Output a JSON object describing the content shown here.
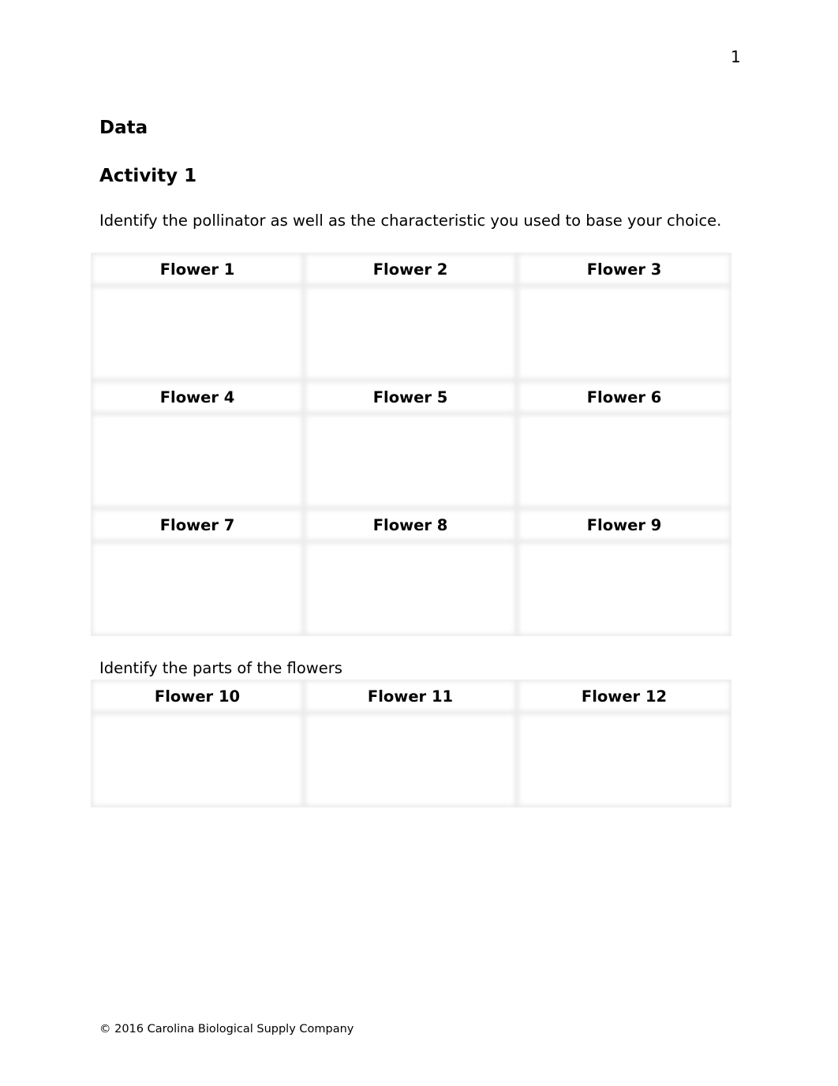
{
  "page_number": "1",
  "heading": "Data",
  "subheading": "Activity 1",
  "instructions_1": "Identify the pollinator as well as the characteristic you used to base your choice.",
  "table_1": {
    "rows": [
      [
        "Flower 1",
        "Flower 2",
        "Flower 3"
      ],
      [
        "Flower 4",
        "Flower 5",
        "Flower 6"
      ],
      [
        "Flower 7",
        "Flower 8",
        "Flower 9"
      ]
    ]
  },
  "instructions_2": "Identify the parts of the flowers",
  "table_2": {
    "rows": [
      [
        "Flower 10",
        "Flower 11",
        "Flower 12"
      ]
    ]
  },
  "footer": "© 2016 Carolina Biological Supply Company"
}
